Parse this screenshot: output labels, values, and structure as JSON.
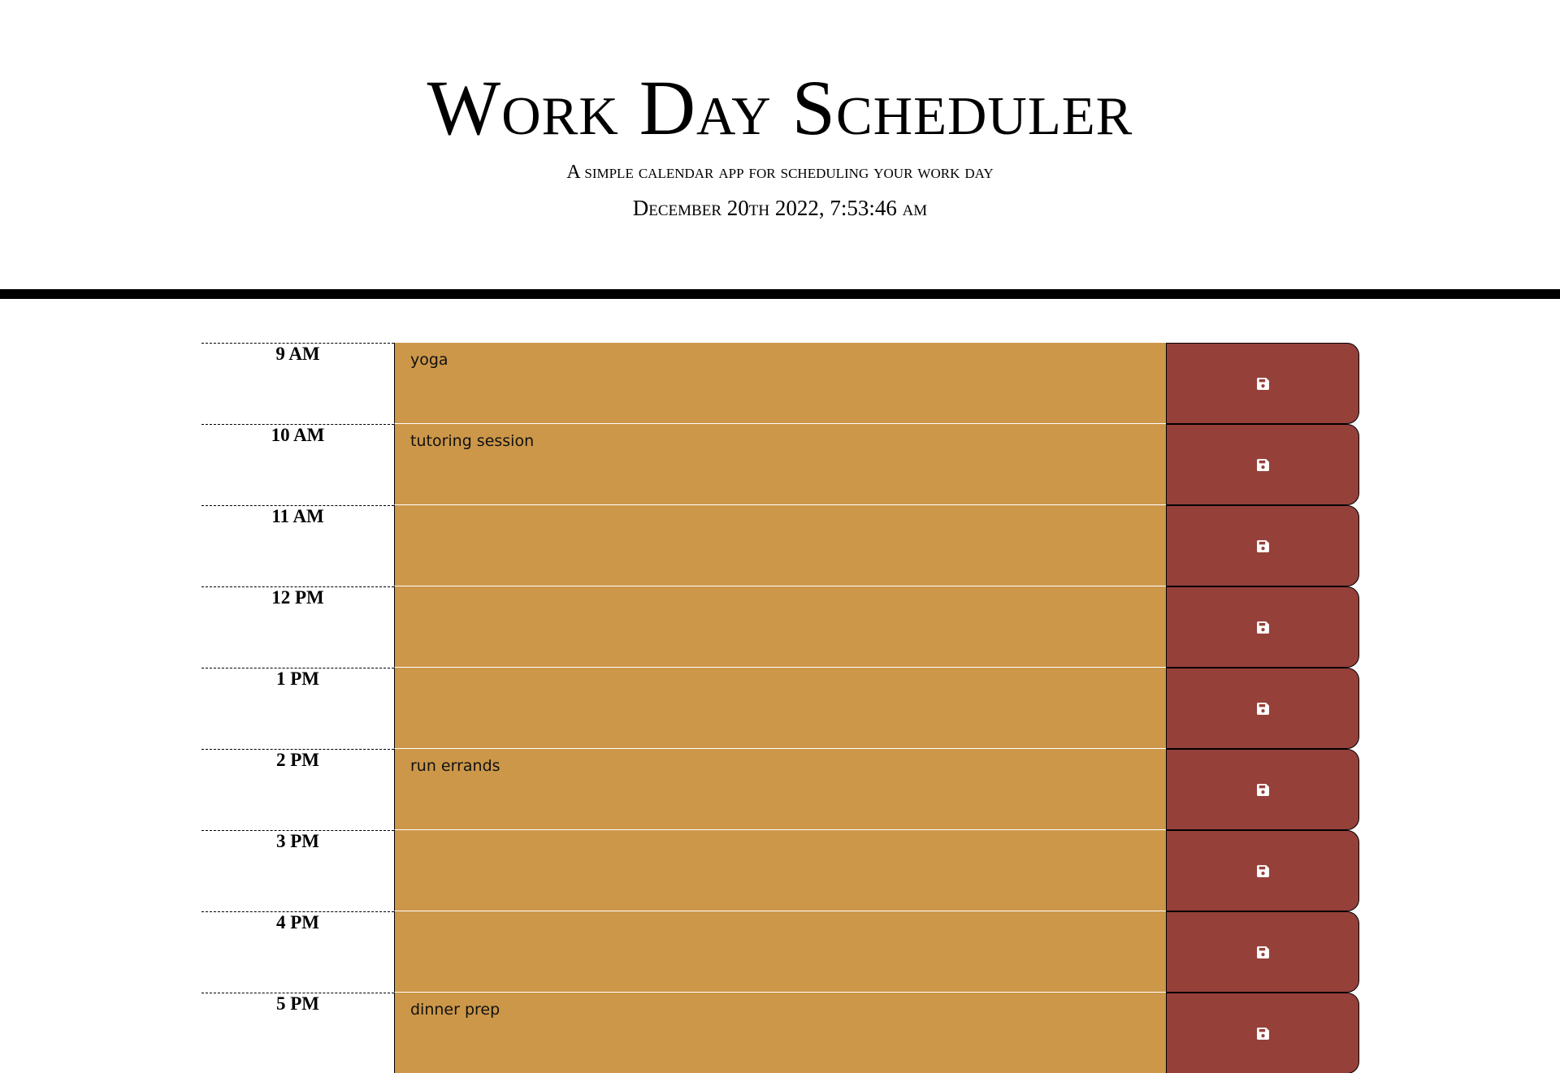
{
  "header": {
    "title": "Work Day Scheduler",
    "lead": "A simple calendar app for scheduling your work day",
    "current_day": "December 20th 2022, 7:53:46 am"
  },
  "colors": {
    "present": "#cc9749",
    "save_button": "#96403a"
  },
  "time_blocks": [
    {
      "hour": "9 AM",
      "description": "yoga",
      "save_icon": "floppy-disk-icon"
    },
    {
      "hour": "10 AM",
      "description": "tutoring session",
      "save_icon": "floppy-disk-icon"
    },
    {
      "hour": "11 AM",
      "description": "",
      "save_icon": "floppy-disk-icon"
    },
    {
      "hour": "12 PM",
      "description": "",
      "save_icon": "floppy-disk-icon"
    },
    {
      "hour": "1 PM",
      "description": "",
      "save_icon": "floppy-disk-icon"
    },
    {
      "hour": "2 PM",
      "description": "run errands",
      "save_icon": "floppy-disk-icon"
    },
    {
      "hour": "3 PM",
      "description": "",
      "save_icon": "floppy-disk-icon"
    },
    {
      "hour": "4 PM",
      "description": "",
      "save_icon": "floppy-disk-icon"
    },
    {
      "hour": "5 PM",
      "description": "dinner prep",
      "save_icon": "floppy-disk-icon"
    }
  ]
}
